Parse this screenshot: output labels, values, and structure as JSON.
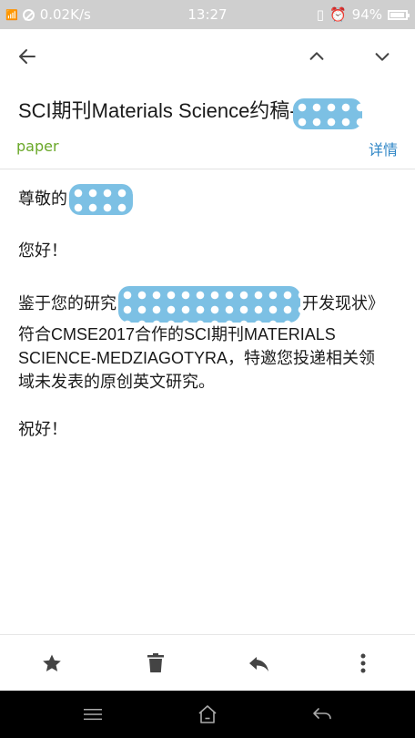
{
  "status_bar": {
    "network_speed": "0.02K/s",
    "time": "13:27",
    "battery": "94%"
  },
  "email": {
    "subject": "SCI期刊Materials Science约稿-",
    "label": "paper",
    "details_link": "详情",
    "greeting": "尊敬的",
    "hello": "您好！",
    "paragraph_part1": "鉴于您的研究",
    "paragraph_part2": "开发现状》符合CMSE2017合作的SCI期刊MATERIALS SCIENCE-MEDZIAGOTYRA，特邀您投递相关领域未发表的原创英文研究。",
    "closing": "祝好！"
  },
  "icons": {
    "back": "arrow-left-icon",
    "prev": "chevron-up-icon",
    "next": "chevron-down-icon",
    "star": "star-icon",
    "delete": "trash-icon",
    "reply": "reply-icon",
    "more": "more-vertical-icon",
    "menu": "menu-icon",
    "home": "home-icon",
    "nav_back": "back-icon"
  },
  "colors": {
    "label": "#6aa829",
    "link": "#2f86c6",
    "redaction": "#7cc0e4"
  }
}
